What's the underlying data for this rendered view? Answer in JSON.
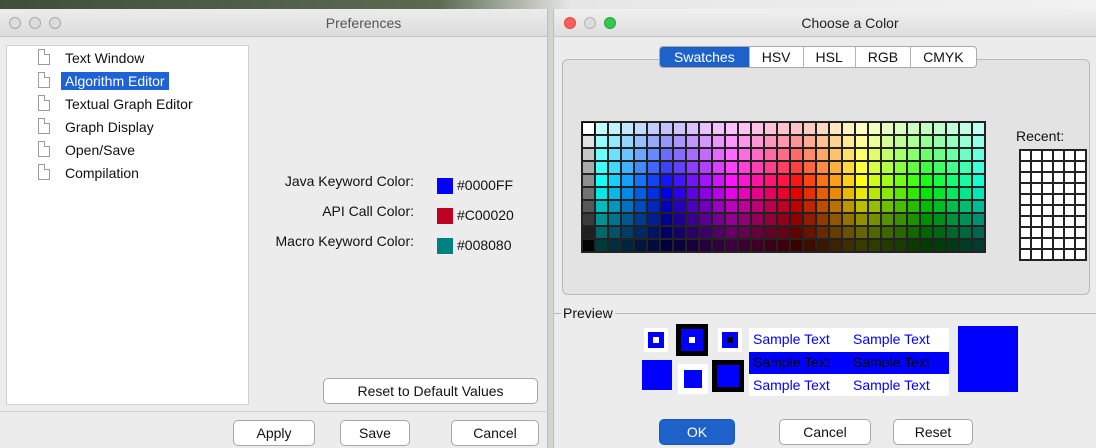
{
  "preferences": {
    "title": "Preferences",
    "tree_items": [
      {
        "label": "Text Window",
        "selected": false
      },
      {
        "label": "Algorithm Editor",
        "selected": true
      },
      {
        "label": "Textual Graph Editor",
        "selected": false
      },
      {
        "label": "Graph Display",
        "selected": false
      },
      {
        "label": "Open/Save",
        "selected": false
      },
      {
        "label": "Compilation",
        "selected": false
      }
    ],
    "color_rows": [
      {
        "label": "Java Keyword Color:",
        "hex": "#0000FF"
      },
      {
        "label": "API Call Color:",
        "hex": "#C00020"
      },
      {
        "label": "Macro Keyword Color:",
        "hex": "#008080"
      }
    ],
    "reset_button": "Reset to Default Values",
    "apply_button": "Apply",
    "save_button": "Save",
    "cancel_button": "Cancel"
  },
  "chooser": {
    "title": "Choose a Color",
    "tabs": [
      "Swatches",
      "HSV",
      "HSL",
      "RGB",
      "CMYK"
    ],
    "active_tab": "Swatches",
    "recent_label": "Recent:",
    "preview_label": "Preview",
    "sample_text": "Sample Text",
    "ok_button": "OK",
    "cancel_button": "Cancel",
    "reset_button": "Reset",
    "selected_color": "#0000FF"
  },
  "colors": {
    "accent": "#1D63D6",
    "close": "#FC605C",
    "minimize": "#FDBC40",
    "zoom": "#34C84A"
  }
}
